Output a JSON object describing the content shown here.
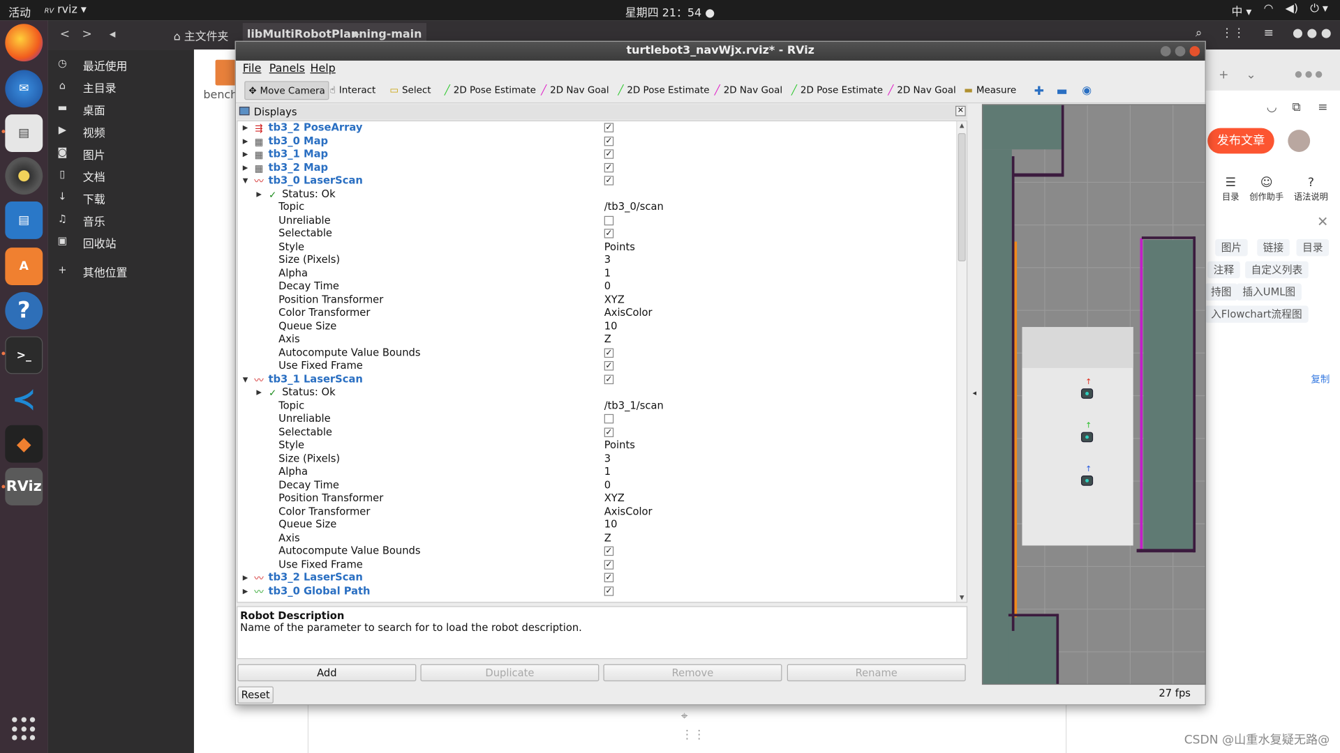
{
  "topbar": {
    "activities": "活动",
    "app_name": "rviz ▾",
    "clock": "星期四 21：54 ●",
    "input_method": "中 ▾"
  },
  "file_manager": {
    "crumb_home": "主文件夹",
    "crumb_folder": "libMultiRobotPlanning-main",
    "sidebar": [
      {
        "label": "最近使用",
        "icon": "clock-icon"
      },
      {
        "label": "主目录",
        "icon": "home-icon"
      },
      {
        "label": "桌面",
        "icon": "folder-icon"
      },
      {
        "label": "视频",
        "icon": "video-icon"
      },
      {
        "label": "图片",
        "icon": "camera-icon"
      },
      {
        "label": "文档",
        "icon": "document-icon"
      },
      {
        "label": "下载",
        "icon": "download-icon"
      },
      {
        "label": "音乐",
        "icon": "music-icon"
      },
      {
        "label": "回收站",
        "icon": "trash-icon"
      },
      {
        "label": "其他位置",
        "icon": "plus-icon"
      }
    ],
    "file_label": "benchr"
  },
  "browser": {
    "publish": "发布文章",
    "tools": [
      "目录",
      "创作助手",
      "语法说明"
    ],
    "chips": [
      "图片",
      "链接",
      "目录",
      "注释",
      "自定义列表",
      "持图",
      "插入UML图",
      "入Flowchart流程图"
    ],
    "copy": "复制"
  },
  "watermark": "CSDN @山重水复疑无路@",
  "rviz": {
    "title": "turtlebot3_navWjx.rviz* - RViz",
    "menu": [
      "File",
      "Panels",
      "Help"
    ],
    "tools": [
      {
        "label": "Move Camera",
        "glyph": "✥",
        "color": "#555555",
        "active": true
      },
      {
        "label": "Interact",
        "glyph": "☝",
        "color": "#333333"
      },
      {
        "label": "Select",
        "glyph": "▭",
        "color": "#c8a000"
      },
      {
        "label": "2D Pose Estimate",
        "glyph": "╱",
        "color": "#2ec82e"
      },
      {
        "label": "2D Nav Goal",
        "glyph": "╱",
        "color": "#e020c8"
      },
      {
        "label": "2D Pose Estimate",
        "glyph": "╱",
        "color": "#2ec82e"
      },
      {
        "label": "2D Nav Goal",
        "glyph": "╱",
        "color": "#e020c8"
      },
      {
        "label": "2D Pose Estimate",
        "glyph": "╱",
        "color": "#2ec82e"
      },
      {
        "label": "2D Nav Goal",
        "glyph": "╱",
        "color": "#e020c8"
      },
      {
        "label": "Measure",
        "glyph": "▬",
        "color": "#b09030"
      }
    ],
    "displays_title": "Displays",
    "tree": [
      {
        "name": "tb3_2 PoseArray",
        "level": 0,
        "arrow": "▶",
        "icon": "posearray-icon",
        "glyph": "⇶",
        "color": "#d02020",
        "checkbox": "checked"
      },
      {
        "name": "tb3_0 Map",
        "level": 0,
        "arrow": "▶",
        "icon": "map-icon",
        "glyph": "▦",
        "color": "#555555",
        "checkbox": "checked"
      },
      {
        "name": "tb3_1 Map",
        "level": 0,
        "arrow": "▶",
        "icon": "map-icon",
        "glyph": "▦",
        "color": "#555555",
        "checkbox": "checked"
      },
      {
        "name": "tb3_2 Map",
        "level": 0,
        "arrow": "▶",
        "icon": "map-icon",
        "glyph": "▦",
        "color": "#555555",
        "checkbox": "checked"
      },
      {
        "name": "tb3_0 LaserScan",
        "level": 0,
        "arrow": "▼",
        "icon": "laserscan-icon",
        "glyph": "〰",
        "color": "#d02020",
        "checkbox": "checked"
      },
      {
        "name": "Status: Ok",
        "level": 1,
        "arrow": "▶",
        "icon": "checkmark-icon",
        "glyph": "✓",
        "color": "#1a8a1a"
      },
      {
        "name": "Topic",
        "level": 2,
        "value": "/tb3_0/scan"
      },
      {
        "name": "Unreliable",
        "level": 2,
        "checkbox": "unchecked"
      },
      {
        "name": "Selectable",
        "level": 2,
        "checkbox": "checked"
      },
      {
        "name": "Style",
        "level": 2,
        "value": "Points"
      },
      {
        "name": "Size (Pixels)",
        "level": 2,
        "value": "3"
      },
      {
        "name": "Alpha",
        "level": 2,
        "value": "1"
      },
      {
        "name": "Decay Time",
        "level": 2,
        "value": "0"
      },
      {
        "name": "Position Transformer",
        "level": 2,
        "value": "XYZ"
      },
      {
        "name": "Color Transformer",
        "level": 2,
        "value": "AxisColor"
      },
      {
        "name": "Queue Size",
        "level": 2,
        "value": "10"
      },
      {
        "name": "Axis",
        "level": 2,
        "value": "Z"
      },
      {
        "name": "Autocompute Value Bounds",
        "level": 2,
        "checkbox": "checked"
      },
      {
        "name": "Use Fixed Frame",
        "level": 2,
        "checkbox": "checked"
      },
      {
        "name": "tb3_1 LaserScan",
        "level": 0,
        "arrow": "▼",
        "icon": "laserscan-icon",
        "glyph": "〰",
        "color": "#d02020",
        "checkbox": "checked"
      },
      {
        "name": "Status: Ok",
        "level": 1,
        "arrow": "▶",
        "icon": "checkmark-icon",
        "glyph": "✓",
        "color": "#1a8a1a"
      },
      {
        "name": "Topic",
        "level": 2,
        "value": "/tb3_1/scan"
      },
      {
        "name": "Unreliable",
        "level": 2,
        "checkbox": "unchecked"
      },
      {
        "name": "Selectable",
        "level": 2,
        "checkbox": "checked"
      },
      {
        "name": "Style",
        "level": 2,
        "value": "Points"
      },
      {
        "name": "Size (Pixels)",
        "level": 2,
        "value": "3"
      },
      {
        "name": "Alpha",
        "level": 2,
        "value": "1"
      },
      {
        "name": "Decay Time",
        "level": 2,
        "value": "0"
      },
      {
        "name": "Position Transformer",
        "level": 2,
        "value": "XYZ"
      },
      {
        "name": "Color Transformer",
        "level": 2,
        "value": "AxisColor"
      },
      {
        "name": "Queue Size",
        "level": 2,
        "value": "10"
      },
      {
        "name": "Axis",
        "level": 2,
        "value": "Z"
      },
      {
        "name": "Autocompute Value Bounds",
        "level": 2,
        "checkbox": "checked"
      },
      {
        "name": "Use Fixed Frame",
        "level": 2,
        "checkbox": "checked"
      },
      {
        "name": "tb3_2 LaserScan",
        "level": 0,
        "arrow": "▶",
        "icon": "laserscan-icon",
        "glyph": "〰",
        "color": "#d02020",
        "checkbox": "checked"
      },
      {
        "name": "tb3_0 Global Path",
        "level": 0,
        "arrow": "▶",
        "icon": "path-icon",
        "glyph": "〰",
        "color": "#20a020",
        "checkbox": "checked"
      }
    ],
    "description": {
      "title": "Robot Description",
      "text": "Name of the parameter to search for to load the robot description."
    },
    "buttons": {
      "add": "Add",
      "duplicate": "Duplicate",
      "remove": "Remove",
      "rename": "Rename",
      "reset": "Reset"
    },
    "fps": "27 fps"
  }
}
